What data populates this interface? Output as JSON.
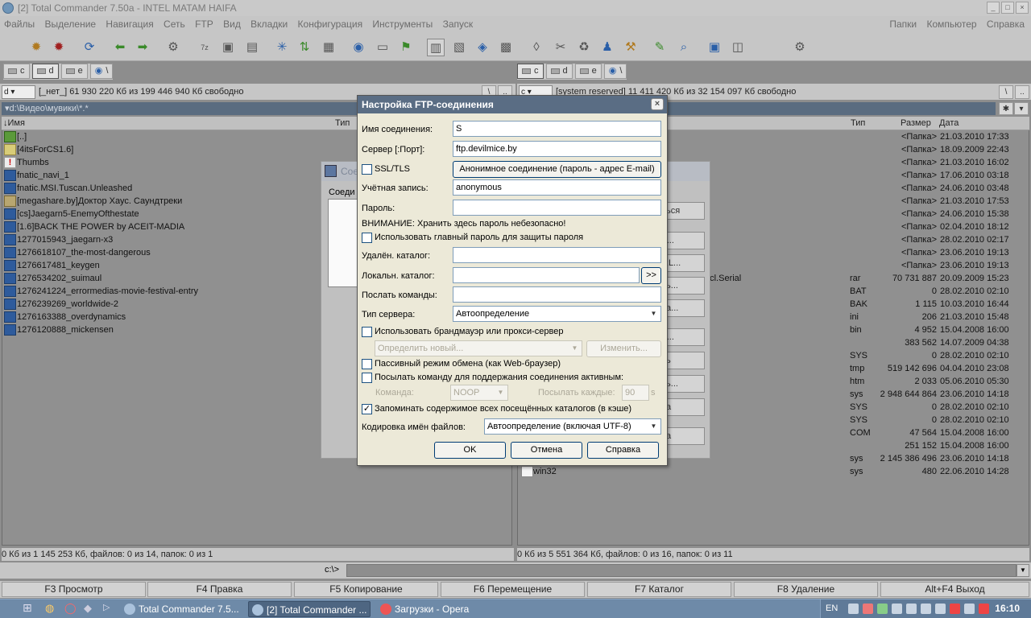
{
  "window": {
    "title": "[2] Total Commander 7.50a - INTEL MATAM HAIFA"
  },
  "menu": {
    "items": [
      "Файлы",
      "Выделение",
      "Навигация",
      "Сеть",
      "FTP",
      "Вид",
      "Вкладки",
      "Конфигурация",
      "Инструменты",
      "Запуск"
    ],
    "right_items": [
      "Папки",
      "Компьютер",
      "Справка"
    ]
  },
  "drives": {
    "left": [
      "c",
      "d",
      "e",
      "\\"
    ],
    "right": [
      "c",
      "d",
      "e",
      "\\"
    ]
  },
  "left_panel": {
    "drive_combo": "d",
    "drive_info": "[_нет_]  61 930 220 Кб из 199 446 940 Кб свободно",
    "path": "d:\\Видео\\мувики\\*.*",
    "col_name": "Имя",
    "col_type": "Тип",
    "files": [
      {
        "name": "[..]",
        "icon": "up"
      },
      {
        "name": "[4itsForCS1.6]",
        "icon": "folder"
      },
      {
        "name": "Thumbs",
        "icon": "warn"
      },
      {
        "name": "fnatic_navi_1",
        "icon": "xvid"
      },
      {
        "name": "fnatic.MSI.Tuscan.Unleashed",
        "icon": "xvid"
      },
      {
        "name": "[megashare.by]Доктор Хаус. Саундтреки",
        "icon": "exe"
      },
      {
        "name": "[cs]Jaegarn5-EnemyOfthestate",
        "icon": "xvid"
      },
      {
        "name": "[1.6]BACK THE POWER by ACEIT-MADIA",
        "icon": "xvid"
      },
      {
        "name": "1277015943_jaegarn-x3",
        "icon": "xvid"
      },
      {
        "name": "1276618107_the-most-dangerous",
        "icon": "xvid"
      },
      {
        "name": "1276617481_keygen",
        "icon": "xvid"
      },
      {
        "name": "1276534202_suimaul",
        "icon": "xvid"
      },
      {
        "name": "1276241224_errormedias-movie-festival-entry",
        "icon": "xvid"
      },
      {
        "name": "1276239269_worldwide-2",
        "icon": "xvid"
      },
      {
        "name": "1276163388_overdynamics",
        "icon": "xvid"
      },
      {
        "name": "1276120888_mickensen",
        "icon": "xvid"
      }
    ],
    "status": "0 Кб из 1 145 253 Кб, файлов: 0 из 14, папок: 0 из 1"
  },
  "right_panel": {
    "drive_combo": "c",
    "drive_info": "[system reserved]  11 411 420 Кб из 32 154 097 Кб свободно",
    "col_type": "Тип",
    "col_size": "Размер",
    "col_date": "Дата",
    "partial_name": "ncl.Serial",
    "last_file": "win32",
    "rows": [
      {
        "type": "",
        "size": "<Папка>",
        "date": "21.03.2010 17:33"
      },
      {
        "type": "",
        "size": "<Папка>",
        "date": "18.09.2009 22:43"
      },
      {
        "type": "",
        "size": "<Папка>",
        "date": "21.03.2010 16:02"
      },
      {
        "type": "",
        "size": "<Папка>",
        "date": "17.06.2010 03:18"
      },
      {
        "type": "",
        "size": "<Папка>",
        "date": "24.06.2010 03:48"
      },
      {
        "type": "",
        "size": "<Папка>",
        "date": "21.03.2010 17:53"
      },
      {
        "type": "",
        "size": "<Папка>",
        "date": "24.06.2010 15:38"
      },
      {
        "type": "",
        "size": "<Папка>",
        "date": "02.04.2010 18:12"
      },
      {
        "type": "",
        "size": "<Папка>",
        "date": "28.02.2010 02:17"
      },
      {
        "type": "",
        "size": "<Папка>",
        "date": "23.06.2010 19:13"
      },
      {
        "type": "",
        "size": "<Папка>",
        "date": "23.06.2010 19:13"
      },
      {
        "type": "rar",
        "size": "70 731 887",
        "date": "20.09.2009 15:23"
      },
      {
        "type": "BAT",
        "size": "0",
        "date": "28.02.2010 02:10"
      },
      {
        "type": "BAK",
        "size": "1 115",
        "date": "10.03.2010 16:44"
      },
      {
        "type": "ini",
        "size": "206",
        "date": "21.03.2010 15:48"
      },
      {
        "type": "bin",
        "size": "4 952",
        "date": "15.04.2008 16:00"
      },
      {
        "type": "",
        "size": "383 562",
        "date": "14.07.2009 04:38"
      },
      {
        "type": "SYS",
        "size": "0",
        "date": "28.02.2010 02:10"
      },
      {
        "type": "tmp",
        "size": "519 142 696",
        "date": "04.04.2010 23:08"
      },
      {
        "type": "htm",
        "size": "2 033",
        "date": "05.06.2010 05:30"
      },
      {
        "type": "sys",
        "size": "2 948 644 864",
        "date": "23.06.2010 14:18"
      },
      {
        "type": "SYS",
        "size": "0",
        "date": "28.02.2010 02:10"
      },
      {
        "type": "SYS",
        "size": "0",
        "date": "28.02.2010 02:10"
      },
      {
        "type": "COM",
        "size": "47 564",
        "date": "15.04.2008 16:00"
      },
      {
        "type": "",
        "size": "251 152",
        "date": "15.04.2008 16:00"
      },
      {
        "type": "sys",
        "size": "2 145 386 496",
        "date": "23.06.2010 14:18"
      },
      {
        "type": "sys",
        "size": "480",
        "date": "22.06.2010 14:28"
      }
    ],
    "status": "0 Кб из 5 551 364 Кб, файлов: 0 из 16, папок: 0 из 11"
  },
  "cmdline": {
    "prompt": "c:\\>"
  },
  "fkeys": [
    "F3 Просмотр",
    "F4 Правка",
    "F5 Копирование",
    "F6 Перемещение",
    "F7 Каталог",
    "F8 Удаление",
    "Alt+F4 Выход"
  ],
  "background_dialog": {
    "title": "Сое",
    "label": "Соеди",
    "buttons": [
      "ться",
      "ь...",
      "RL...",
      "ть...",
      "ка...",
      "ь...",
      "ть",
      "ть...",
      "ка",
      "ка"
    ]
  },
  "ftp_dialog": {
    "title": "Настройка FTP-соединения",
    "conn_name_label": "Имя соединения:",
    "conn_name_value": "S",
    "server_label": "Сервер [:Порт]:",
    "server_value": "ftp.devilmice.by",
    "ssl_label": "SSL/TLS",
    "anon_button": "Анонимное соединение (пароль - адрес E-mail)",
    "account_label": "Учётная запись:",
    "account_value": "anonymous",
    "password_label": "Пароль:",
    "password_value": "",
    "warning": "ВНИМАНИЕ: Хранить здесь пароль небезопасно!",
    "master_pw_label": "Использовать главный пароль для защиты пароля",
    "remote_dir_label": "Удалён. каталог:",
    "local_dir_label": "Локальн. каталог:",
    "browse_button": ">>",
    "send_cmds_label": "Послать команды:",
    "server_type_label": "Тип сервера:",
    "server_type_value": "Автоопределение",
    "firewall_label": "Использовать брандмауэр или прокси-сервер",
    "firewall_select": "Определить новый...",
    "firewall_change": "Изменить...",
    "passive_label": "Пассивный режим обмена (как Web-браузер)",
    "keepalive_label": "Посылать команду для поддержания соединения активным:",
    "command_label": "Команда:",
    "command_value": "NOOP",
    "send_every_label": "Посылать каждые:",
    "send_every_value": "90",
    "send_every_unit": "s",
    "cache_label": "Запоминать содержимое всех посещённых каталогов (в кэше)",
    "encoding_label": "Кодировка имён файлов:",
    "encoding_value": "Автоопределение (включая UTF-8)",
    "ok": "OK",
    "cancel": "Отмена",
    "help": "Справка",
    "checks": {
      "ssl": false,
      "master_pw": false,
      "firewall": false,
      "passive": false,
      "keepalive": false,
      "cache": true
    }
  },
  "taskbar": {
    "tasks": [
      "Total Commander 7.5...",
      "[2] Total Commander ...",
      "Загрузки - Opera"
    ],
    "lang": "EN",
    "clock": "16:10"
  }
}
